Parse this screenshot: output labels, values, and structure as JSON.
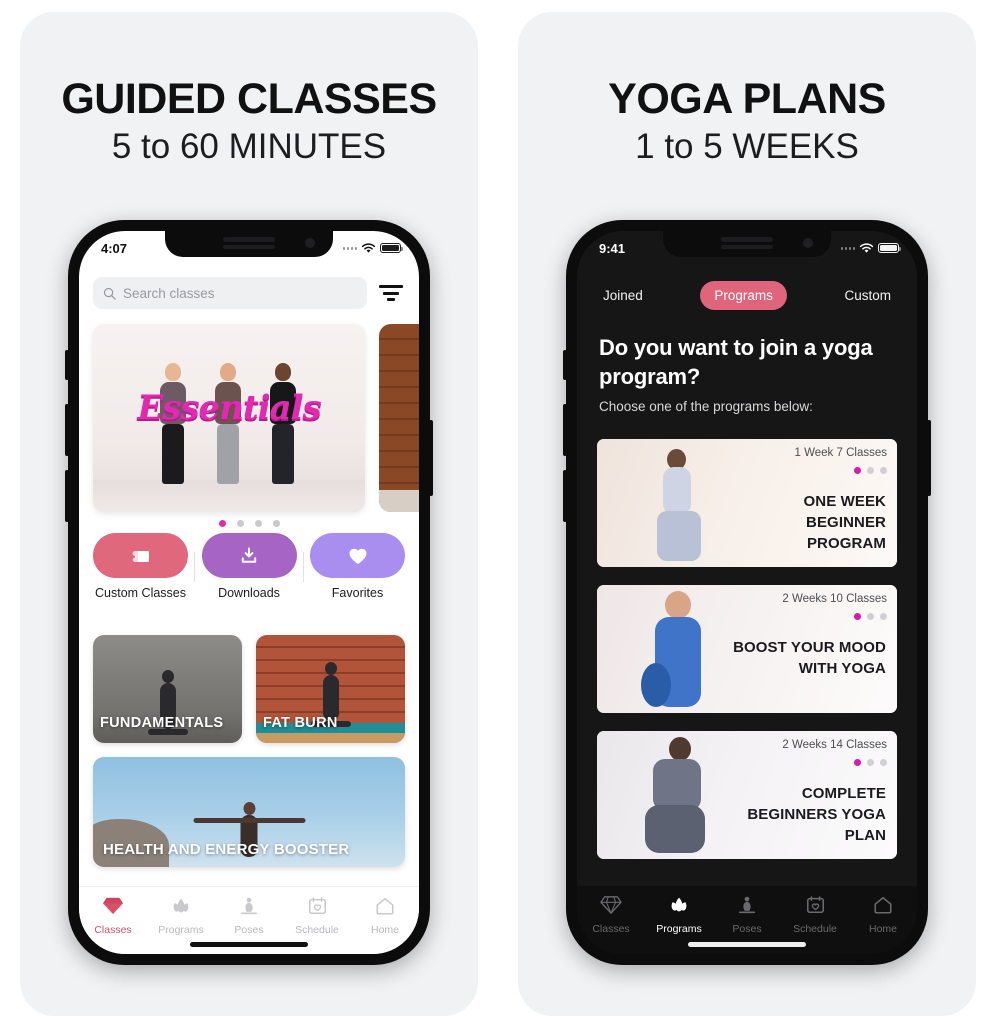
{
  "left_panel": {
    "headline_line1": "GUIDED CLASSES",
    "headline_line2": "5 to 60 MINUTES",
    "status": {
      "time": "4:07"
    },
    "search": {
      "placeholder": "Search classes",
      "icon": "search-icon"
    },
    "filter_icon": "filter-icon",
    "carousel": {
      "hero_title": "Essentials",
      "dots_total": 4,
      "dots_active_index": 0
    },
    "quick_actions": [
      {
        "label": "Custom Classes",
        "icon": "mat-icon",
        "color": "#e0687c"
      },
      {
        "label": "Downloads",
        "icon": "download-icon",
        "color": "#a665c4"
      },
      {
        "label": "Favorites",
        "icon": "heart-icon",
        "color": "#a98ef0"
      }
    ],
    "tiles": [
      {
        "caption": "FUNDAMENTALS"
      },
      {
        "caption": "FAT BURN"
      }
    ],
    "wide_card": {
      "caption": "HEALTH AND ENERGY BOOSTER"
    },
    "tabs": [
      {
        "label": "Classes",
        "icon": "diamond-icon",
        "active": true
      },
      {
        "label": "Programs",
        "icon": "lotus-icon",
        "active": false
      },
      {
        "label": "Poses",
        "icon": "meditate-icon",
        "active": false
      },
      {
        "label": "Schedule",
        "icon": "calendar-heart-icon",
        "active": false
      },
      {
        "label": "Home",
        "icon": "home-icon",
        "active": false
      }
    ]
  },
  "right_panel": {
    "headline_line1": "YOGA PLANS",
    "headline_line2": "1 to 5 WEEKS",
    "status": {
      "time": "9:41"
    },
    "segments": [
      {
        "label": "Joined",
        "active": false
      },
      {
        "label": "Programs",
        "active": true
      },
      {
        "label": "Custom",
        "active": false
      }
    ],
    "title": "Do you want to join a yoga program?",
    "subtitle": "Choose one of the programs below:",
    "programs": [
      {
        "meta": "1 Week 7 Classes",
        "title": "ONE WEEK BEGINNER PROGRAM",
        "level_dots": 3,
        "level_filled": 1
      },
      {
        "meta": "2 Weeks 10 Classes",
        "title": "BOOST YOUR MOOD WITH YOGA",
        "level_dots": 3,
        "level_filled": 1
      },
      {
        "meta": "2 Weeks 14 Classes",
        "title": "COMPLETE BEGINNERS YOGA PLAN",
        "level_dots": 3,
        "level_filled": 1
      }
    ],
    "tabs": [
      {
        "label": "Classes",
        "icon": "diamond-icon",
        "active": false
      },
      {
        "label": "Programs",
        "icon": "lotus-icon",
        "active": true
      },
      {
        "label": "Poses",
        "icon": "meditate-icon",
        "active": false
      },
      {
        "label": "Schedule",
        "icon": "calendar-heart-icon",
        "active": false
      },
      {
        "label": "Home",
        "icon": "home-icon",
        "active": false
      }
    ]
  },
  "colors": {
    "accent_pink": "#e0647c",
    "accent_magenta": "#d619b0",
    "panel_bg": "#f1f2f4",
    "dark_bg": "#161616"
  }
}
